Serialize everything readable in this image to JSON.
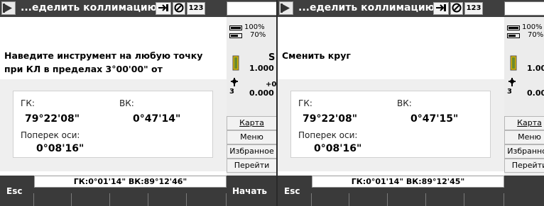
{
  "panes": [
    {
      "title": "...еделить коллимацию",
      "instruction": "Наведите инструмент на любую точку при КЛ в пределах 3°00'00\" от",
      "hz_label": "ГК:",
      "hz_value": "79°22'08\"",
      "v_label": "ВК:",
      "v_value": "0°47'14\"",
      "cross_label": "Поперек оси:",
      "cross_value": "0°08'16\"",
      "status_line": "ГК:0°01'14\"  ВК:89°12'46\"",
      "f1": "Esc",
      "f6": "Начать"
    },
    {
      "title": "...еделить коллимацию",
      "instruction": "Сменить круг",
      "hz_label": "ГК:",
      "hz_value": "79°22'08\"",
      "v_label": "ВК:",
      "v_value": "0°47'15\"",
      "cross_label": "Поперек оси:",
      "cross_value": "0°08'16\"",
      "status_line": "ГК:0°01'14\"  ВК:89°12'45\"",
      "f1": "Esc",
      "f6": ""
    }
  ],
  "titlebar": {
    "input_mode": "123",
    "help": "?",
    "minimize": "—",
    "close": "×"
  },
  "side": {
    "battery_1": "100%",
    "battery_2": "70%",
    "prism_mode": "S",
    "prism_const": "1.000",
    "target_plus": "+0",
    "target_count": "3",
    "target_const": "0.000",
    "menu": [
      "Карта",
      "Меню",
      "Избранное",
      "Перейти"
    ]
  },
  "colors": {
    "titlebar": "#3f3f3f",
    "fkey_bar": "#3a3a3a",
    "side_panel": "#ececec"
  }
}
